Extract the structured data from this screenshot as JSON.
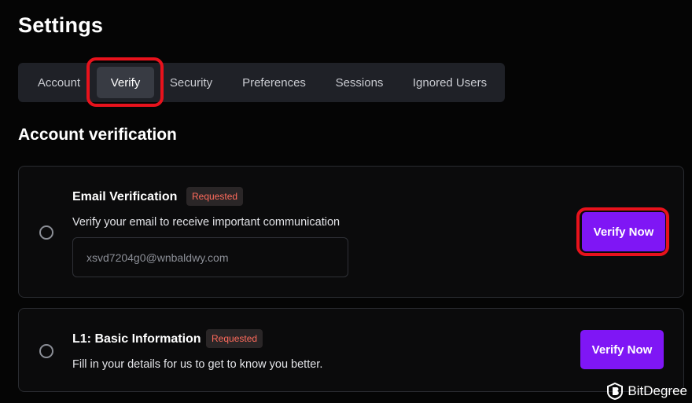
{
  "page": {
    "title": "Settings"
  },
  "tabs": [
    {
      "label": "Account"
    },
    {
      "label": "Verify"
    },
    {
      "label": "Security"
    },
    {
      "label": "Preferences"
    },
    {
      "label": "Sessions"
    },
    {
      "label": "Ignored Users"
    }
  ],
  "active_tab": "Verify",
  "section": {
    "title": "Account verification"
  },
  "cards": {
    "email": {
      "title": "Email Verification",
      "badge": "Requested",
      "description": "Verify your email to receive important communication",
      "email_value": "xsvd7204g0@wnbaldwy.com",
      "button": "Verify Now"
    },
    "basic": {
      "title": "L1: Basic Information",
      "badge": "Requested",
      "description": "Fill in your details for us to get to know you better.",
      "button": "Verify Now"
    }
  },
  "watermark": {
    "brand": "BitDegree"
  },
  "colors": {
    "accent": "#7f16f5",
    "highlight": "#e8121c",
    "badge_text": "#ff6b5c",
    "background": "#050505"
  }
}
